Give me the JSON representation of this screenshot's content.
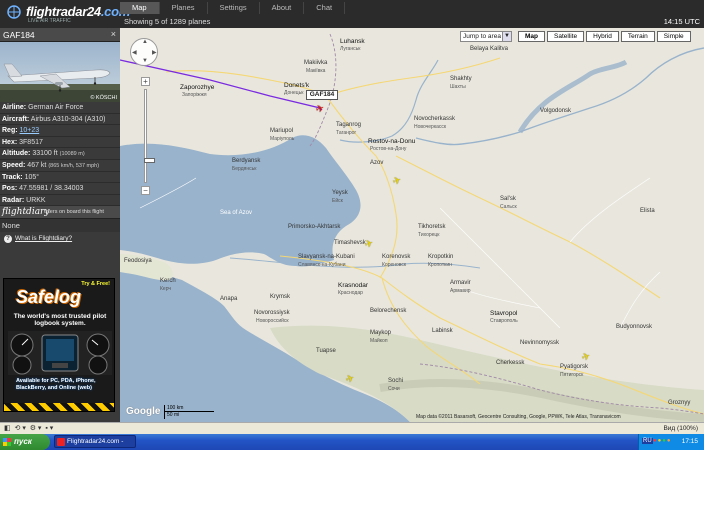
{
  "app": {
    "logo_text": "flightradar24",
    "logo_suffix": ".com",
    "logo_tagline": "LIVE AIR TRAFFIC",
    "nav_tabs": [
      {
        "label": "Map",
        "active": true
      },
      {
        "label": "Planes",
        "active": false
      },
      {
        "label": "Settings",
        "active": false
      },
      {
        "label": "About",
        "active": false
      },
      {
        "label": "Chat",
        "active": false
      }
    ],
    "status_text": "Showing 5 of 1289 planes",
    "clock": "14:15 UTC"
  },
  "panel": {
    "flight_id": "GAF184",
    "close_glyph": "×",
    "photo_credit": "© KÖSCHI",
    "rows": {
      "airline_key": "Airline:",
      "airline_val": "German Air Force",
      "aircraft_key": "Aircraft:",
      "aircraft_val": "Airbus A310-304 (A310)",
      "reg_key": "Reg:",
      "reg_val": "10+23",
      "hex_key": "Hex:",
      "hex_val": "3F8517",
      "altitude_key": "Altitude:",
      "altitude_val": "33100 ft",
      "altitude_extra": "(10089 m)",
      "speed_key": "Speed:",
      "speed_val": "467 kt",
      "speed_extra": "(865 km/h, 537 mph)",
      "track_key": "Track:",
      "track_val": "105°",
      "pos_key": "Pos:",
      "pos_val": "47.55981 / 38.34003",
      "radar_key": "Radar:",
      "radar_val": "URKK"
    },
    "flightdiary_logo": "flightdiary",
    "flightdiary_tag": "users on board this flight",
    "none_text": "None",
    "what_link": "What is Flightdiary?"
  },
  "ad": {
    "brand": "Safelog",
    "try": "Try & Free!",
    "headline": "The world's most trusted pilot logbook system.",
    "footer": "Available for PC, PDA, iPhone, BlackBerry, and Online (web)"
  },
  "map": {
    "jump_label": "Jump to area",
    "types": [
      {
        "label": "Map",
        "active": true
      },
      {
        "label": "Satellite",
        "active": false
      },
      {
        "label": "Hybrid",
        "active": false
      },
      {
        "label": "Terrain",
        "active": false
      },
      {
        "label": "Simple",
        "active": false
      }
    ],
    "callout": "GAF184",
    "google": "Google",
    "scale_top": "100 km",
    "scale_bottom": "50 mi",
    "attribution": "Map data ©2011 Basarsoft, Geocentre Consulting, Google, PPWK, Tele Atlas, Transnavicom",
    "labels": {
      "zaporozhye": "Zaporozhye",
      "zaporozhye_sub": "Запоріжжя",
      "makiivka": "Makiivka",
      "makiivka_sub": "Макіївка",
      "donetsk": "Donets'k",
      "donetsk_sub": "Донецьк",
      "luhansk": "Luhansk",
      "luhansk_sub": "Луганськ",
      "mariupol": "Mariupol",
      "mariupol_sub": "Маріуполь",
      "taganrog": "Taganrog",
      "taganrog_sub": "Таганрог",
      "shakhty": "Shakhty",
      "shakhty_sub": "Шахты",
      "novocherkassk": "Novocherkassk",
      "novocherkassk_sub": "Новочеркасск",
      "rostov": "Rostov-na-Donu",
      "rostov_sub": "Ростов-на-Дону",
      "berdyansk": "Berdyansk",
      "berdyansk_sub": "Бердянськ",
      "sea_azov": "Sea of Azov",
      "yeysk": "Yeysk",
      "yeysk_sub": "Ейск",
      "timashevsk": "Timashevsk",
      "slavyansk": "Slavyansk-na-Kubani",
      "slavyansk_sub": "Славянск-на-Кубани",
      "krasnodar": "Krasnodar",
      "krasnodar_sub": "Краснодар",
      "armavir": "Armavir",
      "armavir_sub": "Армавир",
      "stavropol": "Stavropol",
      "stavropol_sub": "Ставрополь",
      "novorossiysk": "Novorossiysk",
      "novorossiysk_sub": "Новороссийск",
      "maykop": "Maykop",
      "maykop_sub": "Майкоп",
      "sochi": "Sochi",
      "sochi_sub": "Сочи",
      "cherkessk": "Cherkessk",
      "pyatigorsk": "Pyatigorsk",
      "pyatigorsk_sub": "Пятигорск",
      "nevinnomyssk": "Nevinnomyssk",
      "kropotkin": "Kropotkin",
      "kropotkin_sub": "Кропоткин",
      "tikhoretsk": "Tikhoretsk",
      "tikhoretsk_sub": "Тихорецк",
      "salsk": "Sal'sk",
      "salsk_sub": "Сальск",
      "volgodonsk": "Volgodonsk",
      "belaya_kalitva": "Belaya Kalitva",
      "kerch": "Kerch",
      "kerch_sub": "Керч",
      "feodosiya": "Feodosiya",
      "budyonnovsk": "Budyonnovsk",
      "grozny": "Groznyy",
      "korenovsk": "Korenovsk",
      "korenovsk_sub": "Кореновск",
      "belorechensk": "Belorechensk",
      "labinsk": "Labinsk",
      "crimsk": "Krymsk",
      "anapa": "Anapa",
      "primorsko": "Primorsko-Akhtarsk",
      "tuapse": "Tuapse",
      "azov": "Azov",
      "elista": "Elista"
    }
  },
  "browser": {
    "zoom": "Вид (100%)"
  },
  "taskbar": {
    "start_label": "пуск",
    "task_label": "Flightradar24.com - U...",
    "lang": "RU",
    "clock": "17:15"
  }
}
